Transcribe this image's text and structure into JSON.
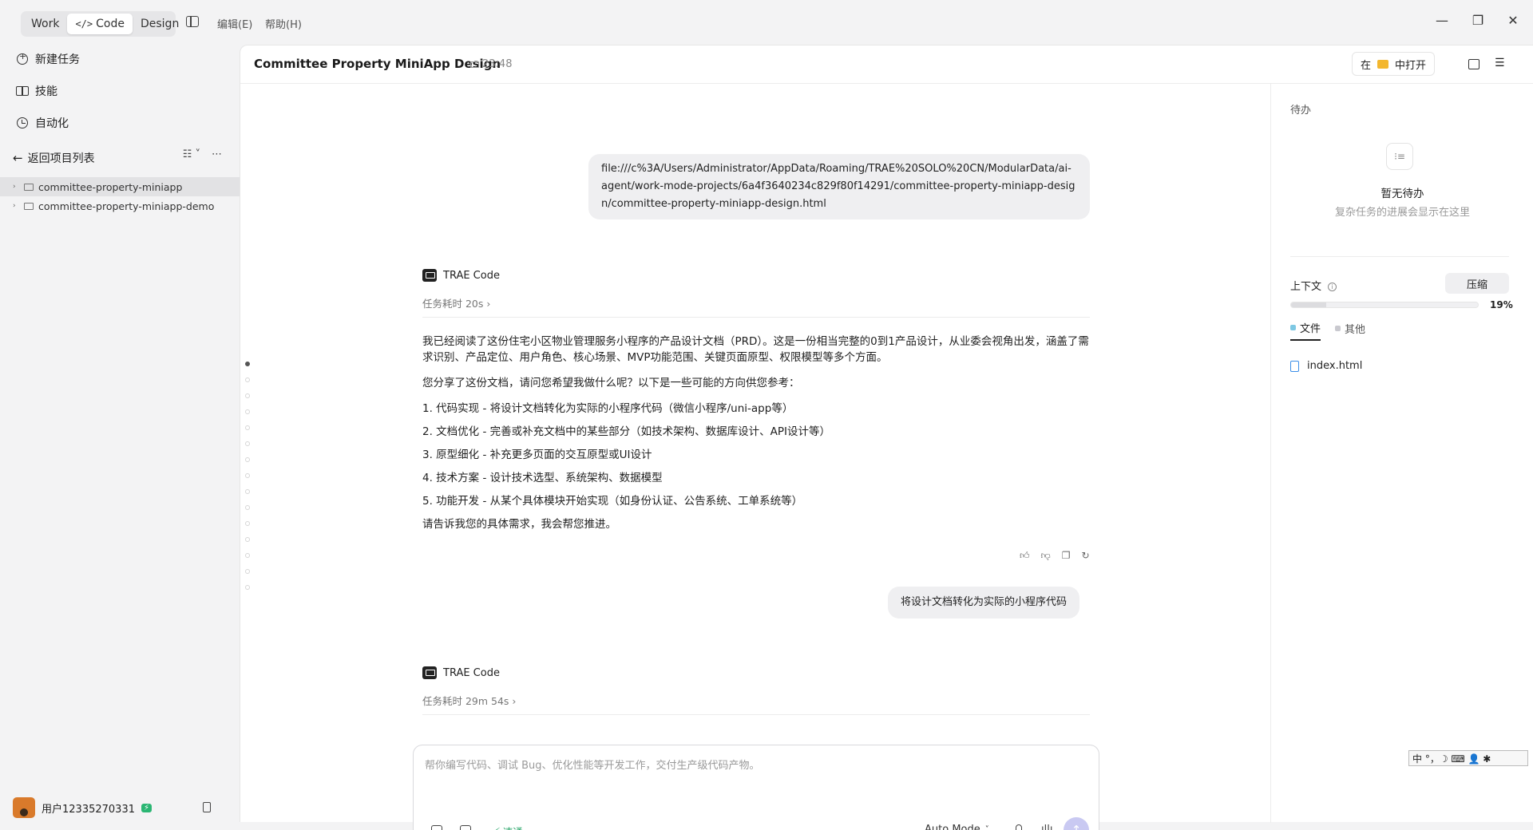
{
  "titlebar": {
    "modes": [
      "Work",
      "Code",
      "Design"
    ],
    "active_mode": "Code",
    "menu": [
      "编辑(E)",
      "帮助(H)"
    ],
    "window_controls": [
      "minimize-icon",
      "restore-icon",
      "close-icon"
    ]
  },
  "sidebar": {
    "nav": [
      {
        "label": "新建任务",
        "icon": "new-task-icon"
      },
      {
        "label": "技能",
        "icon": "book-icon"
      },
      {
        "label": "自动化",
        "icon": "clock-icon"
      }
    ],
    "back_label": "返回项目列表",
    "projects": [
      "committee-property-miniapp",
      "committee-property-miniapp-demo"
    ],
    "user": {
      "name": "用户12335270331"
    }
  },
  "main": {
    "title": "Committee Property MiniApp Design",
    "time": "23:48",
    "open_in": {
      "prefix": "在",
      "suffix": "中打开"
    }
  },
  "chat": {
    "user_msg_1": "file:///c%3A/Users/Administrator/AppData/Roaming/TRAE%20SOLO%20CN/ModularData/ai-agent/work-mode-projects/6a4f3640234c829f80f14291/committee-property-miniapp-design/committee-property-miniapp-design.html",
    "agent_name": "TRAE Code",
    "duration_1": "任务耗时 20s",
    "reply_p1": "我已经阅读了这份住宅小区物业管理服务小程序的产品设计文档（PRD）。这是一份相当完整的0到1产品设计，从业委会视角出发，涵盖了需求识别、产品定位、用户角色、核心场景、MVP功能范围、关键页面原型、权限模型等多个方面。",
    "reply_p2": "您分享了这份文档，请问您希望我做什么呢？以下是一些可能的方向供您参考：",
    "reply_list": [
      "1. 代码实现 - 将设计文档转化为实际的小程序代码（微信小程序/uni-app等）",
      "2. 文档优化 - 完善或补充文档中的某些部分（如技术架构、数据库设计、API设计等）",
      "3. 原型细化 - 补充更多页面的交互原型或UI设计",
      "4. 技术方案 - 设计技术选型、系统架构、数据模型",
      "5. 功能开发 - 从某个具体模块开始实现（如身份认证、公告系统、工单系统等）"
    ],
    "reply_p3": "请告诉我您的具体需求，我会帮您推进。",
    "user_msg_2": "将设计文档转化为实际的小程序代码",
    "duration_2": "任务耗时 29m 54s"
  },
  "composer": {
    "placeholder": "帮你编写代码、调试 Bug、优化性能等开发工作，交付生产级代码产物。",
    "speed_label": "速通",
    "mode_label": "Auto Mode"
  },
  "right_panel": {
    "todo_label": "待办",
    "todo_empty_title": "暂无待办",
    "todo_empty_sub": "复杂任务的进展会显示在这里",
    "context_label": "上下文",
    "compress_label": "压缩",
    "context_percent": "19%",
    "context_fraction": 0.19,
    "tabs": [
      {
        "label": "文件",
        "color": "#7ec8e3"
      },
      {
        "label": "其他",
        "color": "#c9c9cf"
      }
    ],
    "files": [
      "index.html"
    ]
  },
  "ime": {
    "text": "中 °，☽ ⌨ 👤 ✱"
  }
}
